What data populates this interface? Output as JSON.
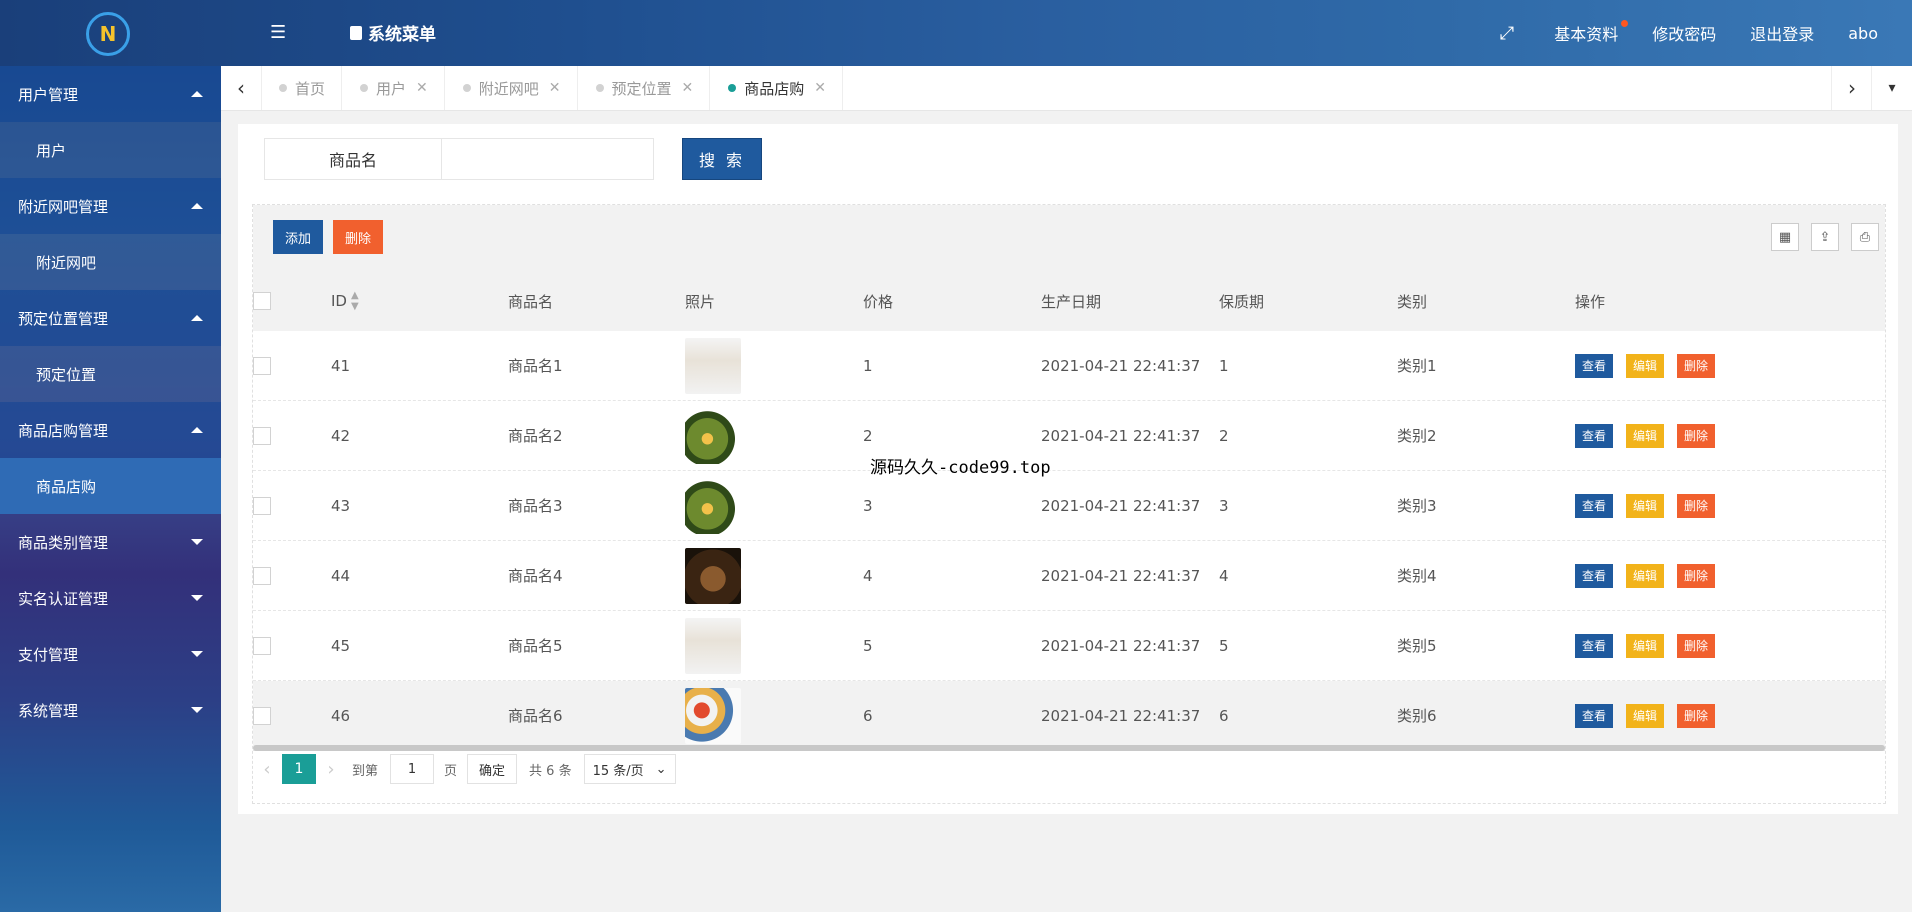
{
  "header": {
    "logo": "N",
    "system_menu": "系统菜单",
    "profile": "基本资料",
    "change_password": "修改密码",
    "logout": "退出登录",
    "username": "abo"
  },
  "sidebar": {
    "groups": [
      {
        "label": "用户管理",
        "sub": "用户"
      },
      {
        "label": "附近网吧管理",
        "sub": "附近网吧"
      },
      {
        "label": "预定位置管理",
        "sub": "预定位置"
      },
      {
        "label": "商品店购管理",
        "sub": "商品店购"
      }
    ],
    "collapsed": [
      "商品类别管理",
      "实名认证管理",
      "支付管理",
      "系统管理"
    ]
  },
  "tabs": [
    {
      "label": "首页"
    },
    {
      "label": "用户"
    },
    {
      "label": "附近网吧"
    },
    {
      "label": "预定位置"
    },
    {
      "label": "商品店购"
    }
  ],
  "search": {
    "label": "商品名",
    "value": "",
    "button": "搜 索"
  },
  "toolbar": {
    "add": "添加",
    "delete": "删除"
  },
  "table": {
    "columns": [
      "ID",
      "商品名",
      "照片",
      "价格",
      "生产日期",
      "保质期",
      "类别",
      "操作"
    ],
    "rows": [
      {
        "id": "41",
        "name": "商品名1",
        "price": "1",
        "date": "2021-04-21 22:41:37",
        "shelf": "1",
        "category": "类别1"
      },
      {
        "id": "42",
        "name": "商品名2",
        "price": "2",
        "date": "2021-04-21 22:41:37",
        "shelf": "2",
        "category": "类别2"
      },
      {
        "id": "43",
        "name": "商品名3",
        "price": "3",
        "date": "2021-04-21 22:41:37",
        "shelf": "3",
        "category": "类别3"
      },
      {
        "id": "44",
        "name": "商品名4",
        "price": "4",
        "date": "2021-04-21 22:41:37",
        "shelf": "4",
        "category": "类别4"
      },
      {
        "id": "45",
        "name": "商品名5",
        "price": "5",
        "date": "2021-04-21 22:41:37",
        "shelf": "5",
        "category": "类别5"
      },
      {
        "id": "46",
        "name": "商品名6",
        "price": "6",
        "date": "2021-04-21 22:41:37",
        "shelf": "6",
        "category": "类别6"
      }
    ],
    "actions": {
      "view": "查看",
      "edit": "编辑",
      "delete": "删除"
    }
  },
  "pager": {
    "current": "1",
    "goto_label": "到第",
    "page_input": "1",
    "page_unit": "页",
    "confirm": "确定",
    "total": "共 6 条",
    "page_size": "15 条/页"
  },
  "overlay_text": "源码久久-code99.top",
  "colors": {
    "primary": "#1f5a9e",
    "teal": "#1a9e97",
    "orange": "#f1602e",
    "yellow": "#f2b31a"
  }
}
